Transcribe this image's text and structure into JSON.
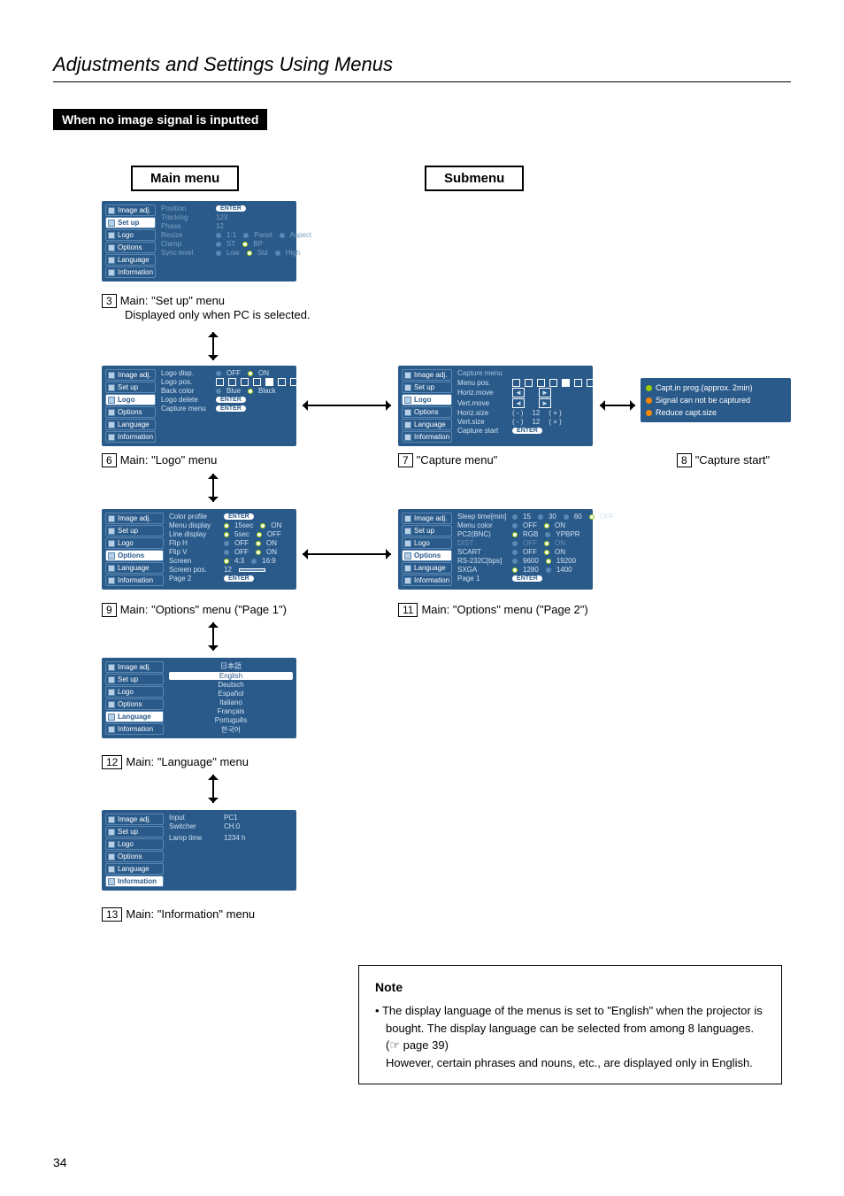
{
  "page_title": "Adjustments and Settings Using Menus",
  "section_banner": "When no image signal is inputted",
  "headers": {
    "main": "Main menu",
    "sub": "Submenu"
  },
  "sidebar_items": [
    "Image adj.",
    "Set up",
    "Logo",
    "Options",
    "Language",
    "Information"
  ],
  "enter_label": "ENTER",
  "panel3": {
    "caption_num": "3",
    "caption": "Main: \"Set up\" menu",
    "caption_sub": "Displayed only when PC is selected.",
    "selected": "Set up",
    "rows": [
      {
        "lbl": "Position",
        "val": "ENTER"
      },
      {
        "lbl": "Tracking",
        "val": "123"
      },
      {
        "lbl": "Phase",
        "val": "12"
      },
      {
        "lbl": "Resize",
        "opts": [
          "1:1",
          "Panel",
          "Aspect"
        ]
      },
      {
        "lbl": "Clamp",
        "opts": [
          "ST",
          "BP"
        ]
      },
      {
        "lbl": "Sync level",
        "opts": [
          "Low",
          "Std",
          "High"
        ]
      }
    ]
  },
  "panel6": {
    "caption_num": "6",
    "caption": "Main: \"Logo\" menu",
    "selected": "Logo",
    "rows": [
      {
        "lbl": "Logo disp.",
        "opts": [
          "OFF",
          "ON"
        ]
      },
      {
        "lbl": "Logo pos.",
        "pos": true
      },
      {
        "lbl": "Back color",
        "opts": [
          "Blue",
          "Black"
        ]
      },
      {
        "lbl": "Logo delete",
        "val": "ENTER"
      },
      {
        "lbl": "Capture menu",
        "val": "ENTER"
      }
    ]
  },
  "panel7": {
    "caption_num": "7",
    "caption": "\"Capture menu\"",
    "selected": "Logo",
    "title": "Capture menu",
    "rows": [
      {
        "lbl": "Menu pos.",
        "pos": true
      },
      {
        "lbl": "Horiz.move",
        "arrows": true
      },
      {
        "lbl": "Vert.move",
        "arrows": true
      },
      {
        "lbl": "Horiz.size",
        "vals": [
          "( - )",
          "12",
          "( + )"
        ]
      },
      {
        "lbl": "Vert.size",
        "vals": [
          "( - )",
          "12",
          "( + )"
        ]
      },
      {
        "lbl": "Capture start",
        "val": "ENTER"
      }
    ]
  },
  "panel8": {
    "caption_num": "8",
    "caption": "\"Capture start\"",
    "rows": [
      {
        "bullet": "#9c0",
        "text": "Capt.in prog.(approx. 2min)"
      },
      {
        "bullet": "#f80",
        "text": "Signal can not be captured"
      },
      {
        "bullet": "#f80",
        "text": "Reduce capt.size"
      }
    ]
  },
  "panel9": {
    "caption_num": "9",
    "caption": "Main: \"Options\" menu (\"Page 1\")",
    "selected": "Options",
    "rows": [
      {
        "lbl": "Color profile",
        "val": "ENTER"
      },
      {
        "lbl": "Menu display",
        "opts": [
          "15sec",
          "ON"
        ]
      },
      {
        "lbl": "Line display",
        "opts": [
          "5sec",
          "OFF"
        ]
      },
      {
        "lbl": "Flip H",
        "opts": [
          "OFF",
          "ON"
        ]
      },
      {
        "lbl": "Flip V",
        "opts": [
          "OFF",
          "ON"
        ]
      },
      {
        "lbl": "Screen",
        "opts": [
          "4:3",
          "16:9"
        ]
      },
      {
        "lbl": "Screen pos.",
        "val": "12",
        "bar": true
      },
      {
        "lbl": "Page 2",
        "val": "ENTER"
      }
    ]
  },
  "panel11": {
    "caption_num": "11",
    "caption": "Main: \"Options\" menu (\"Page 2\")",
    "selected": "Options",
    "rows": [
      {
        "lbl": "Sleep time[min]",
        "opts": [
          "15",
          "30",
          "60",
          "OFF"
        ]
      },
      {
        "lbl": "Menu color",
        "opts": [
          "OFF",
          "ON"
        ]
      },
      {
        "lbl": "PC2(BNC)",
        "opts": [
          "RGB",
          "YPBPR"
        ]
      },
      {
        "lbl": "DIST",
        "opts": [
          "OFF",
          "ON"
        ],
        "dim": true
      },
      {
        "lbl": "SCART",
        "opts": [
          "OFF",
          "ON"
        ]
      },
      {
        "lbl": "RS-232C[bps]",
        "opts": [
          "9600",
          "19200"
        ]
      },
      {
        "lbl": "SXGA",
        "opts": [
          "1280",
          "1400"
        ]
      },
      {
        "lbl": "Page 1",
        "val": "ENTER"
      }
    ]
  },
  "panel12": {
    "caption_num": "12",
    "caption": "Main: \"Language\" menu",
    "selected": "Language",
    "langs": [
      "日本語",
      "English",
      "Deutsch",
      "Español",
      "Italiano",
      "Français",
      "Português",
      "한국어"
    ],
    "selected_lang": "English"
  },
  "panel13": {
    "caption_num": "13",
    "caption": "Main: \"Information\" menu",
    "selected": "Information",
    "rows": [
      {
        "lbl": "Input",
        "val": "PC1"
      },
      {
        "lbl": "Switcher",
        "val": "CH.0"
      },
      {
        "lbl": "",
        "val": ""
      },
      {
        "lbl": "",
        "val": ""
      },
      {
        "lbl": "",
        "val": ""
      },
      {
        "lbl": "Lamp time",
        "val": "1234 h"
      }
    ]
  },
  "note": {
    "title": "Note",
    "body1": "The display language of the menus is set to \"English\" when the projector is bought. The display language can be selected from among 8 languages. (☞ page 39)",
    "body2": "However, certain phrases and nouns, etc., are displayed only in English."
  },
  "page_number": "34"
}
